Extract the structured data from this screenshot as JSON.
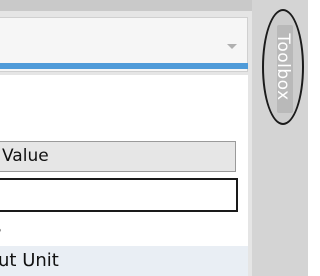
{
  "properties_panel": {
    "column_header": "Value",
    "rows": [
      {
        "label": "s"
      },
      {
        "label": "ut Unit"
      }
    ]
  },
  "dock": {
    "toolbox_tab_label": "Toolbox"
  },
  "colors": {
    "accent": "#4f9bd9",
    "selected_row": "#e9eef4",
    "dock_background": "#d4d4d4"
  },
  "icons": {
    "dropdown": "chevron-down-icon"
  }
}
